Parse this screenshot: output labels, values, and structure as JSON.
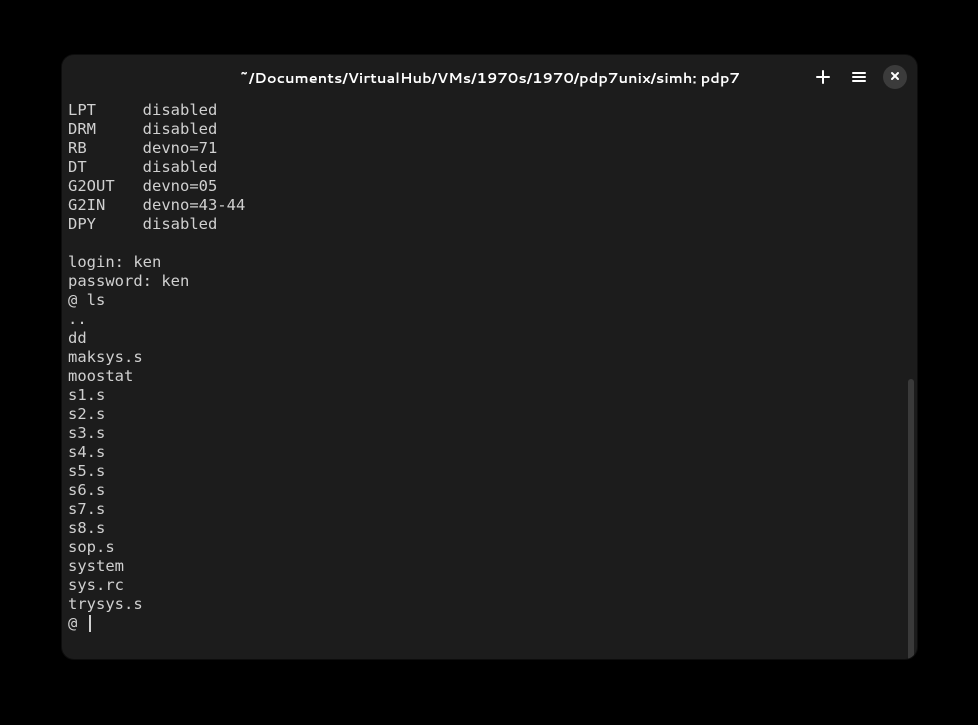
{
  "window": {
    "title": "~/Documents/VirtualHub/VMs/1970s/1970/pdp7unix/simh: pdp7"
  },
  "terminal": {
    "lines": [
      "LPT     disabled",
      "DRM     disabled",
      "RB      devno=71",
      "DT      disabled",
      "G2OUT   devno=05",
      "G2IN    devno=43-44",
      "DPY     disabled",
      "",
      "login: ken",
      "password: ken",
      "@ ls",
      "..",
      "dd",
      "maksys.s",
      "moostat",
      "s1.s",
      "s2.s",
      "s3.s",
      "s4.s",
      "s5.s",
      "s6.s",
      "s7.s",
      "s8.s",
      "sop.s",
      "system",
      "sys.rc",
      "trysys.s"
    ],
    "prompt": "@ "
  }
}
